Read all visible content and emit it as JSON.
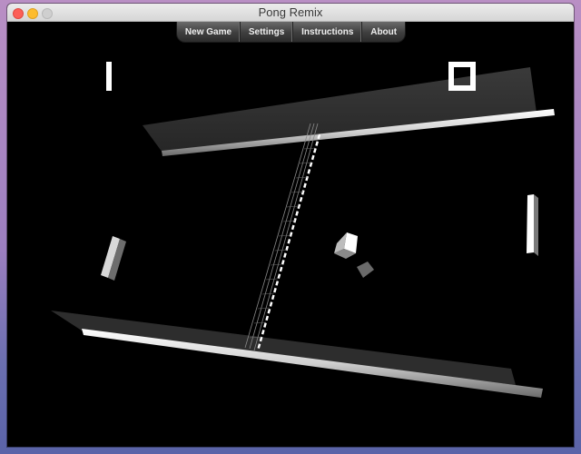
{
  "window": {
    "title": "Pong Remix"
  },
  "menu": {
    "items": [
      {
        "label": "New Game"
      },
      {
        "label": "Settings"
      },
      {
        "label": "Instructions"
      },
      {
        "label": "About"
      }
    ]
  },
  "colors": {
    "menu_bar": "#3e3e3e",
    "background": "#000000",
    "walls": "#2f2f2f",
    "rails": "#e6e6e6"
  }
}
